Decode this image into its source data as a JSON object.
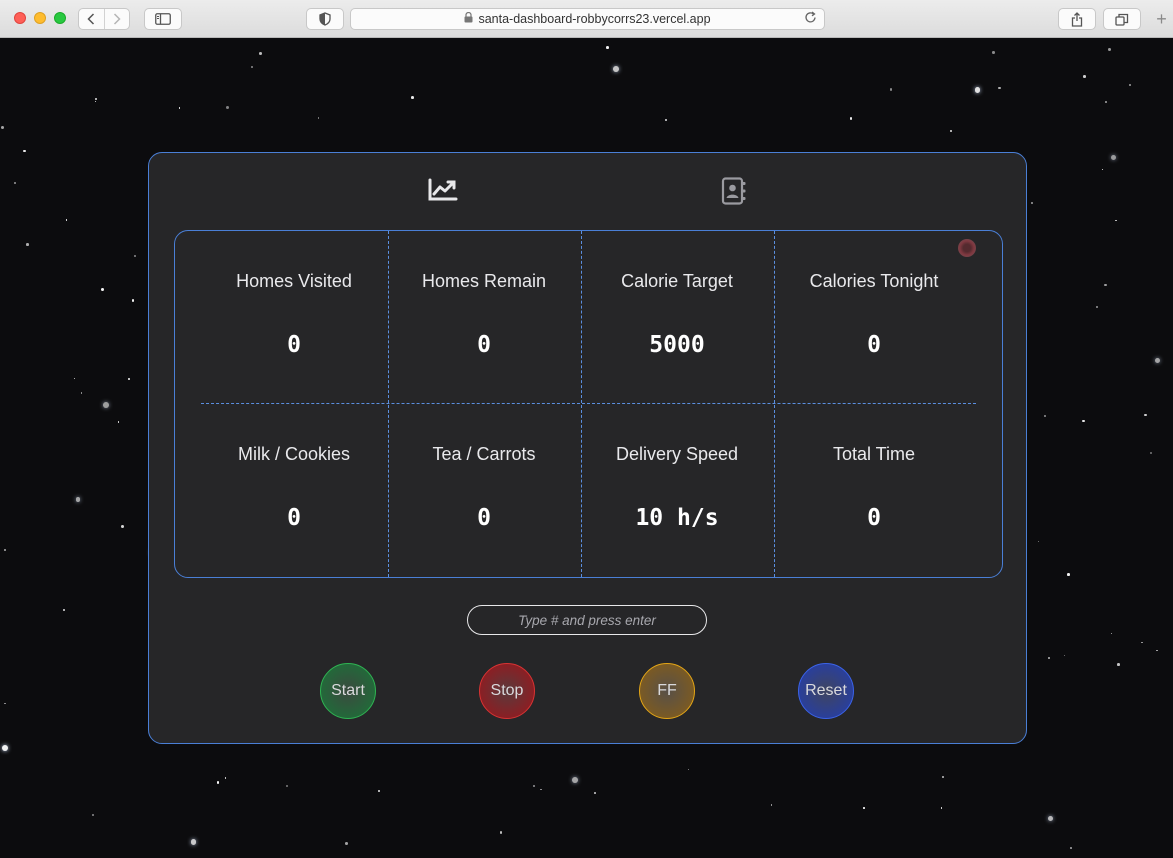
{
  "browser": {
    "url": "santa-dashboard-robbycorrs23.vercel.app",
    "icons": [
      "back-icon",
      "forward-icon",
      "sidebar-icon",
      "shield-icon",
      "lock-icon",
      "reload-icon",
      "share-icon",
      "tabs-icon",
      "plus-icon"
    ]
  },
  "dashboard": {
    "tabs": [
      {
        "icon": "line-chart-icon",
        "active": true
      },
      {
        "icon": "address-book-icon",
        "active": false
      }
    ],
    "stats": [
      {
        "label": "Homes Visited",
        "value": "0"
      },
      {
        "label": "Homes Remain",
        "value": "0"
      },
      {
        "label": "Calorie Target",
        "value": "5000"
      },
      {
        "label": "Calories Tonight",
        "value": "0"
      },
      {
        "label": "Milk / Cookies",
        "value": "0"
      },
      {
        "label": "Tea / Carrots",
        "value": "0"
      },
      {
        "label": "Delivery Speed",
        "value": "10 h/s"
      },
      {
        "label": "Total Time",
        "value": "0"
      }
    ],
    "input": {
      "placeholder": "Type # and press enter",
      "value": ""
    },
    "controls": [
      {
        "label": "Start",
        "color": "#1f8a42"
      },
      {
        "label": "Stop",
        "color": "#a8242a"
      },
      {
        "label": "FF",
        "color": "#a0710c"
      },
      {
        "label": "Reset",
        "color": "#2246c4"
      }
    ],
    "colors": {
      "panel_bg": "#262628",
      "accent_border": "#4a7fd6",
      "page_bg": "#0c0c0e"
    }
  }
}
